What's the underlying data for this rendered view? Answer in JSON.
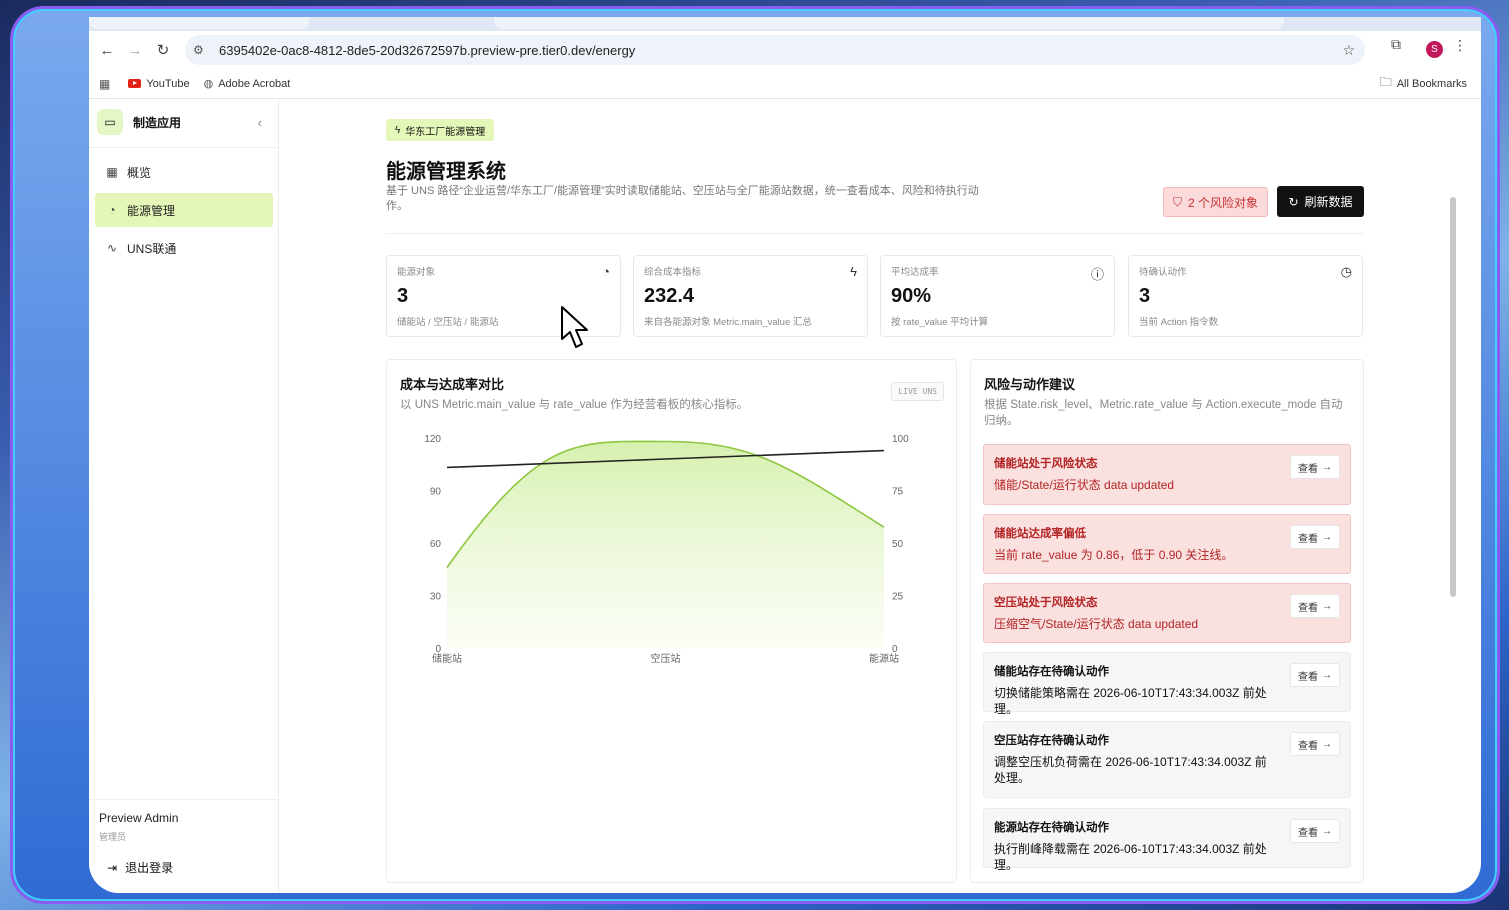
{
  "browser": {
    "url": "6395402e-0ac8-4812-8de5-20d32672597b.preview-pre.tier0.dev/energy",
    "bookmarks": [
      {
        "label": "YouTube"
      },
      {
        "label": "Adobe Acrobat"
      }
    ],
    "all_bookmarks": "All Bookmarks",
    "profile_initial": "S"
  },
  "sidebar": {
    "brand": "制造应用",
    "items": [
      {
        "label": "概览",
        "icon": "grid-icon"
      },
      {
        "label": "能源管理",
        "icon": "gauge-icon",
        "active": true
      },
      {
        "label": "UNS联通",
        "icon": "activity-icon"
      }
    ],
    "user_name": "Preview Admin",
    "user_role": "管理员",
    "logout": "退出登录"
  },
  "header": {
    "badge": "华东工厂能源管理",
    "title": "能源管理系统",
    "description": "基于 UNS 路径“企业运营/华东工厂/能源管理”实时读取储能站、空压站与全厂能源站数据，统一查看成本、风险和待执行动作。",
    "risk_button": "2 个风险对象",
    "refresh_button": "刷新数据"
  },
  "cards": [
    {
      "label": "能源对象",
      "value": "3",
      "sub": "储能站 / 空压站 / 能源站",
      "icon": "gauge-icon"
    },
    {
      "label": "综合成本指标",
      "value": "232.4",
      "sub": "来自各能源对象 Metric.main_value 汇总",
      "icon": "lightning-icon"
    },
    {
      "label": "平均达成率",
      "value": "90%",
      "sub": "按 rate_value 平均计算",
      "icon": "info-icon"
    },
    {
      "label": "待确认动作",
      "value": "3",
      "sub": "当前 Action 指令数",
      "icon": "clock-icon"
    }
  ],
  "chart_panel": {
    "title": "成本与达成率对比",
    "description": "以 UNS Metric.main_value 与 rate_value 作为经营看板的核心指标。",
    "live_tag": "LIVE UNS"
  },
  "chart_data": {
    "type": "area",
    "categories": [
      "储能站",
      "空压站",
      "能源站"
    ],
    "series": [
      {
        "axis": "left",
        "values": [
          46,
          118,
          69
        ],
        "color": "#8dc63f",
        "style": "area"
      },
      {
        "axis": "right",
        "values": [
          86,
          90,
          94
        ],
        "color": "#222222",
        "style": "line"
      }
    ],
    "y_left": {
      "ticks": [
        0,
        30,
        60,
        90,
        120
      ],
      "lim": [
        0,
        120
      ]
    },
    "y_right": {
      "ticks": [
        0,
        25,
        50,
        75,
        100
      ],
      "lim": [
        0,
        100
      ]
    },
    "grid": false
  },
  "risk_panel": {
    "title": "风险与动作建议",
    "description": "根据 State.risk_level、Metric.rate_value 与 Action.execute_mode 自动归纳。",
    "view_label": "查看",
    "items": [
      {
        "title": "储能站处于风险状态",
        "detail": "储能/State/运行状态 data updated",
        "level": "red"
      },
      {
        "title": "储能站达成率偏低",
        "detail": "当前 rate_value 为 0.86，低于 0.90 关注线。",
        "level": "red"
      },
      {
        "title": "空压站处于风险状态",
        "detail": "压缩空气/State/运行状态 data updated",
        "level": "red"
      },
      {
        "title": "储能站存在待确认动作",
        "detail": "切换储能策略需在 2026-06-10T17:43:34.003Z 前处理。",
        "level": "gray"
      },
      {
        "title": "空压站存在待确认动作",
        "detail": "调整空压机负荷需在 2026-06-10T17:43:34.003Z 前处理。",
        "level": "gray"
      },
      {
        "title": "能源站存在待确认动作",
        "detail": "执行削峰降载需在 2026-06-10T17:43:34.003Z 前处理。",
        "level": "gray"
      }
    ]
  }
}
